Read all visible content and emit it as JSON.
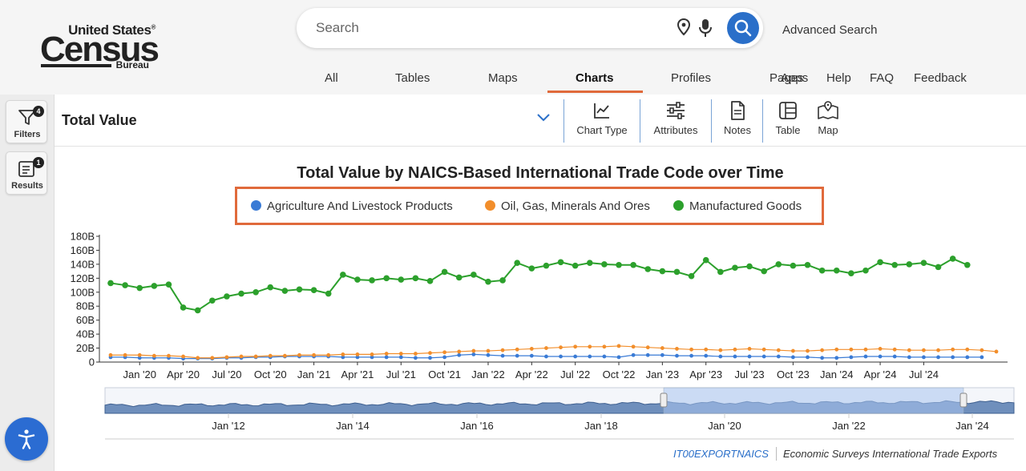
{
  "header": {
    "logo": {
      "line1": "United States",
      "reg": "®",
      "line2": "Census",
      "line3": "Bureau"
    },
    "search_placeholder": "Search",
    "advanced_search": "Advanced Search",
    "nav": [
      {
        "label": "All",
        "active": false
      },
      {
        "label": "Tables",
        "active": false
      },
      {
        "label": "Maps",
        "active": false
      },
      {
        "label": "Charts",
        "active": true
      },
      {
        "label": "Profiles",
        "active": false
      },
      {
        "label": "Pages",
        "active": false
      },
      {
        "label": "Apps",
        "active": false
      },
      {
        "label": "Help",
        "active": false
      },
      {
        "label": "FAQ",
        "active": false
      },
      {
        "label": "Feedback",
        "active": false
      }
    ],
    "accent": "#e06a3b",
    "brand_blue": "#2a6fc9"
  },
  "rail": {
    "filters": {
      "label": "Filters",
      "badge": "4",
      "icon": "filter-icon"
    },
    "results": {
      "label": "Results",
      "badge": "1",
      "icon": "results-icon"
    },
    "accessibility_icon": "accessibility-icon"
  },
  "toolbar": {
    "measure": "Total Value",
    "buttons": [
      {
        "label": "Chart Type",
        "icon": "line-chart-icon"
      },
      {
        "label": "Attributes",
        "icon": "sliders-icon"
      },
      {
        "label": "Notes",
        "icon": "notes-icon"
      },
      {
        "label": "Table",
        "icon": "table-icon"
      },
      {
        "label": "Map",
        "icon": "map-icon"
      }
    ]
  },
  "chart_data": {
    "type": "line",
    "title": "Total Value by NAICS-Based International Trade Code over Time",
    "xlabel": "",
    "ylabel": "",
    "ylim": [
      0,
      180
    ],
    "y_unit": "B",
    "y_ticks": [
      "0",
      "20B",
      "40B",
      "60B",
      "80B",
      "100B",
      "120B",
      "140B",
      "160B",
      "180B"
    ],
    "x_ticks": [
      "Jan '20",
      "Apr '20",
      "Jul '20",
      "Oct '20",
      "Jan '21",
      "Apr '21",
      "Jul '21",
      "Oct '21",
      "Jan '22",
      "Apr '22",
      "Jul '22",
      "Oct '22",
      "Jan '23",
      "Apr '23",
      "Jul '23",
      "Oct '23",
      "Jan '24",
      "Apr '24",
      "Jul '24"
    ],
    "x_start": "Nov 2019",
    "x_end": "Sep 2024",
    "legend_position": "top-center",
    "grid": false,
    "series": [
      {
        "name": "Agriculture And Livestock Products",
        "color": "#3a7bd5",
        "values": [
          7,
          7,
          6,
          6,
          6,
          5,
          5,
          5,
          6,
          6,
          7,
          7,
          8,
          8,
          8,
          8,
          7,
          7,
          7,
          7,
          7,
          6,
          6,
          7,
          10,
          11,
          10,
          9,
          9,
          9,
          8,
          8,
          8,
          8,
          8,
          7,
          10,
          10,
          10,
          9,
          9,
          9,
          8,
          8,
          8,
          8,
          8,
          7,
          7,
          6,
          6,
          7,
          8,
          8,
          8,
          7,
          7,
          7,
          7,
          7,
          7
        ]
      },
      {
        "name": "Oil, Gas, Minerals And Ores",
        "color": "#f28e2b",
        "values": [
          10,
          10,
          10,
          9,
          9,
          8,
          6,
          6,
          7,
          8,
          8,
          9,
          9,
          10,
          10,
          10,
          11,
          11,
          11,
          12,
          12,
          12,
          13,
          14,
          15,
          16,
          16,
          17,
          18,
          19,
          20,
          21,
          22,
          22,
          22,
          23,
          22,
          21,
          20,
          19,
          18,
          18,
          17,
          18,
          19,
          18,
          17,
          16,
          16,
          17,
          18,
          18,
          18,
          19,
          18,
          17,
          17,
          17,
          18,
          18,
          17,
          15
        ]
      },
      {
        "name": "Manufactured Goods",
        "color": "#2ca02c",
        "values": [
          113,
          110,
          106,
          109,
          111,
          78,
          74,
          88,
          94,
          98,
          100,
          107,
          102,
          104,
          103,
          98,
          125,
          118,
          117,
          120,
          118,
          120,
          116,
          129,
          121,
          125,
          115,
          117,
          142,
          134,
          138,
          143,
          138,
          142,
          140,
          139,
          139,
          133,
          130,
          129,
          123,
          146,
          129,
          135,
          137,
          130,
          140,
          138,
          139,
          131,
          131,
          127,
          131,
          143,
          139,
          140,
          142,
          136,
          148,
          139
        ]
      }
    ],
    "navigator": {
      "ticks": [
        "Jan '12",
        "Jan '14",
        "Jan '16",
        "Jan '18",
        "Jan '20",
        "Jan '22",
        "Jan '24"
      ]
    }
  },
  "footer": {
    "source": "IT00EXPORTNAICS",
    "program": "Economic Surveys International Trade Exports"
  }
}
